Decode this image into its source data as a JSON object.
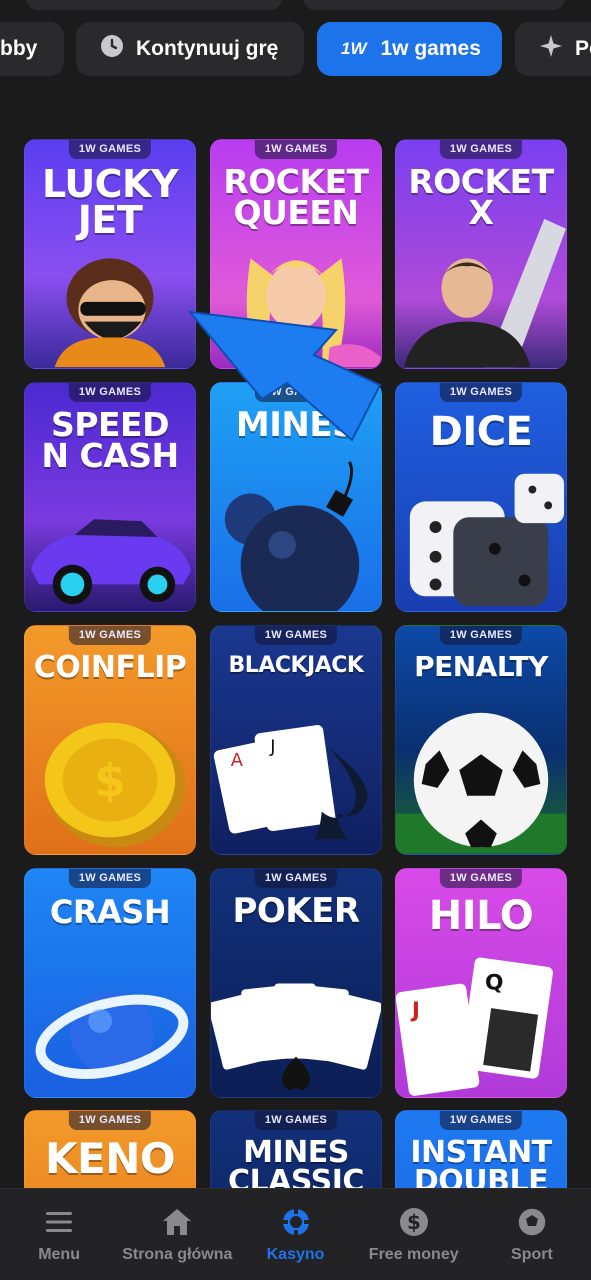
{
  "chips": [
    {
      "label": "bby",
      "active": false
    },
    {
      "label": "Kontynuuj grę",
      "icon": "clock-icon",
      "active": false
    },
    {
      "label": "1w games",
      "icon": "1w-logo-icon",
      "logo_text": "1W",
      "active": true
    },
    {
      "label": "Po",
      "icon": "sparkle-icon",
      "active": false
    }
  ],
  "games": [
    {
      "badge": "1W GAMES",
      "title": "LUCKY\nJET",
      "bg": "#6b3df0"
    },
    {
      "badge": "1W GAMES",
      "title": "ROCKET\nQUEEN",
      "bg": "#c43be0"
    },
    {
      "badge": "1W GAMES",
      "title": "ROCKET\nX",
      "bg": "#7a3ff0"
    },
    {
      "badge": "1W GAMES",
      "title": "SPEED\nN CASH",
      "bg": "#5b2bd8"
    },
    {
      "badge": "1W GAMES",
      "title": "MINES",
      "bg": "#1f86f0"
    },
    {
      "badge": "1W GAMES",
      "title": "DICE",
      "bg": "#1d5fd8"
    },
    {
      "badge": "1W GAMES",
      "title": "COINFLIP",
      "bg": "#f08a22"
    },
    {
      "badge": "1W GAMES",
      "title": "BLACKJACK",
      "bg": "#13307a"
    },
    {
      "badge": "1W GAMES",
      "title": "PENALTY",
      "bg": "#0d4aa8"
    },
    {
      "badge": "1W GAMES",
      "title": "CRASH",
      "bg": "#1a7ff0"
    },
    {
      "badge": "1W GAMES",
      "title": "POKER",
      "bg": "#0e2c72"
    },
    {
      "badge": "1W GAMES",
      "title": "HILO",
      "bg": "#d63ee8"
    },
    {
      "badge": "1W GAMES",
      "title": "KENO",
      "bg": "#f08a22"
    },
    {
      "badge": "1W GAMES",
      "title": "MINES\nCLASSIC",
      "bg": "#12307a"
    },
    {
      "badge": "1W GAMES",
      "title": "INSTANT\nDOUBLE",
      "bg": "#1d6ff0"
    }
  ],
  "nav": [
    {
      "label": "Menu",
      "icon": "menu-icon",
      "active": false
    },
    {
      "label": "Strona główna",
      "icon": "home-icon",
      "active": false
    },
    {
      "label": "Kasyno",
      "icon": "casino-chip-icon",
      "active": true
    },
    {
      "label": "Free money",
      "icon": "dollar-coin-icon",
      "active": false
    },
    {
      "label": "Sport",
      "icon": "soccer-ball-icon",
      "active": false
    }
  ],
  "colors": {
    "accent": "#1d74ea",
    "background": "#1b1b1c",
    "nav_inactive": "#8a8a8e"
  }
}
